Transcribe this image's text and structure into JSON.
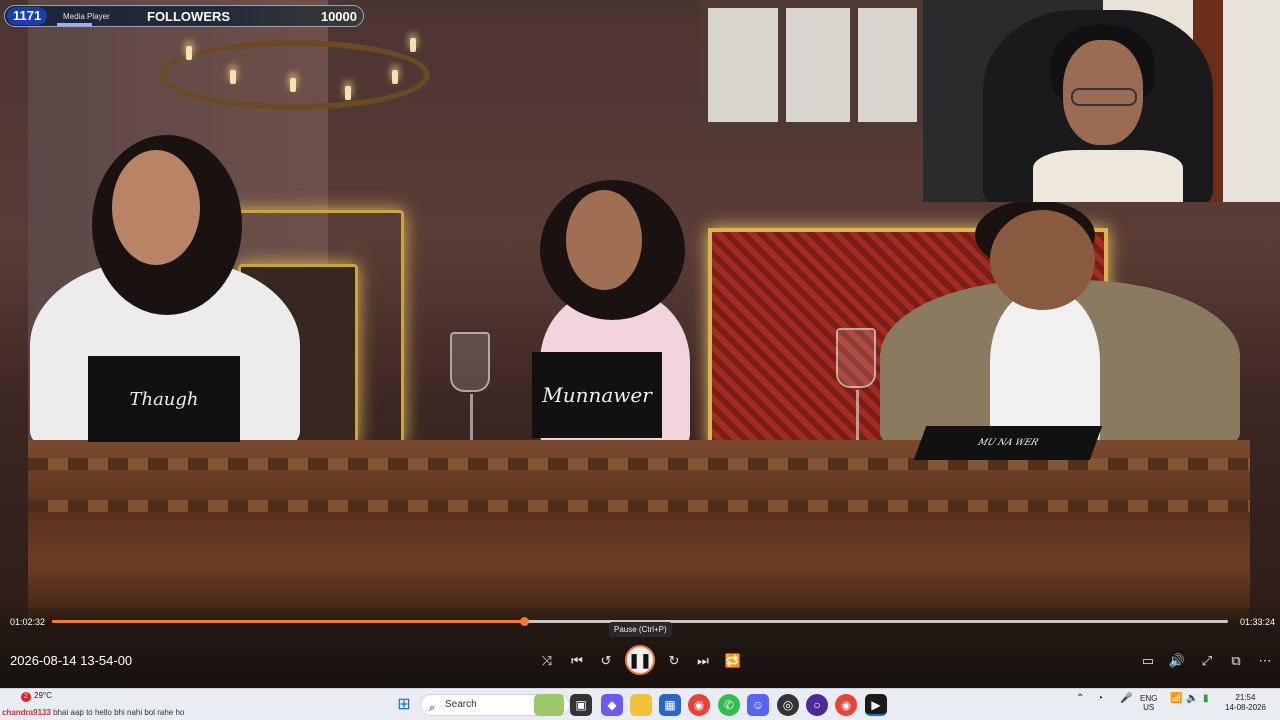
{
  "overlay": {
    "follower_count": "1171",
    "app_name": "Media Player",
    "label": "FOLLOWERS",
    "goal": "10000",
    "progress": 0.117
  },
  "scene": {
    "nameplate_left": "Thaugh",
    "nameplate_center": "Munnawer",
    "nameplate_right": "MU NA WER"
  },
  "player": {
    "current_time": "01:02:32",
    "total_time": "01:33:24",
    "progress": 0.401,
    "tooltip": "Pause (Ctrl+P)",
    "file_timestamp": "2026-08-14 13-54-00",
    "controls": {
      "shuffle": "⤨",
      "previous": "⏮",
      "rewind": "↺",
      "play_pause": "❚❚",
      "forward": "↻",
      "next": "⏭",
      "repeat": "🔁",
      "miniplayer": "▭",
      "volume": "🔊",
      "fullscreen": "⤢",
      "pip": "⧉",
      "more": "⋯"
    }
  },
  "taskbar": {
    "weather": "29°C",
    "notification_count": "2",
    "chat_user": "chandra9133",
    "chat_message": "bhai aap to hello bhi nahi bol rahe ho",
    "search_placeholder": "Search",
    "language": "ENG",
    "region": "US",
    "time": "21:54",
    "date": "14-08-2026"
  }
}
